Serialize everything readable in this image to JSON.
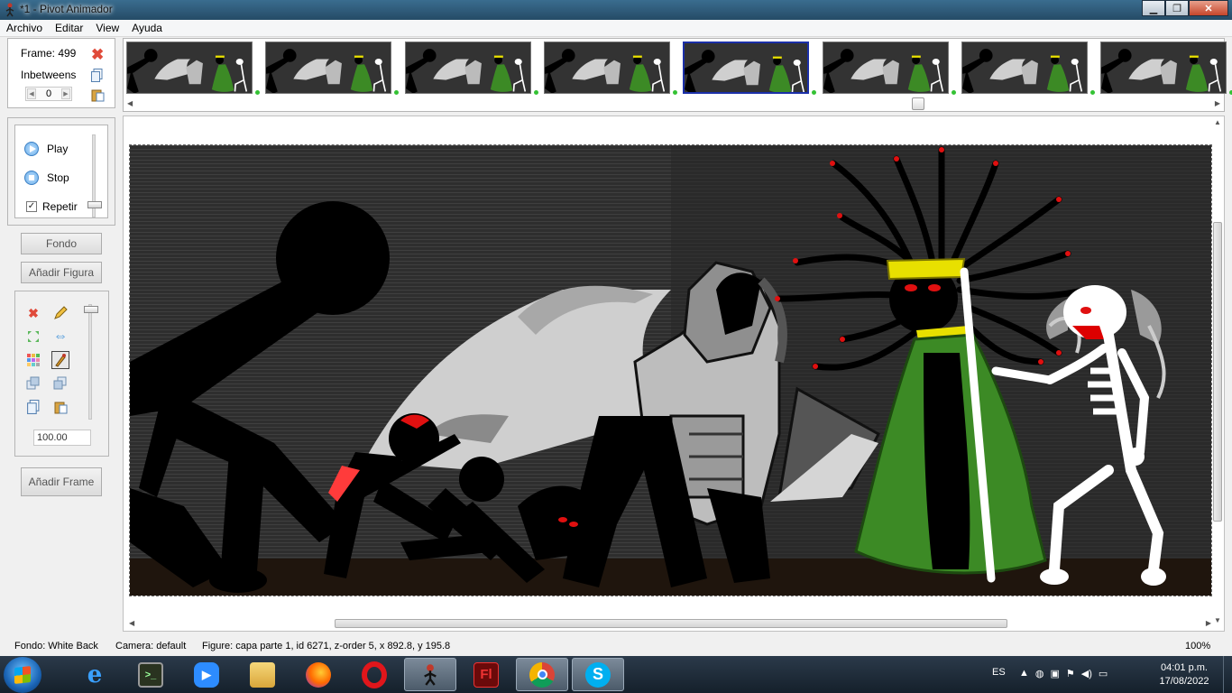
{
  "window": {
    "title": "*1 - Pivot Animador"
  },
  "menu": [
    "Archivo",
    "Editar",
    "View",
    "Ayuda"
  ],
  "frame_panel": {
    "frame_label": "Frame: 499",
    "inbetweens_label": "Inbetweens",
    "inbetweens_value": "0"
  },
  "playback": {
    "play_label": "Play",
    "stop_label": "Stop",
    "repeat_label": "Repetir",
    "repeat_checked": "✓"
  },
  "buttons": {
    "background": "Fondo",
    "add_figure": "Añadir Figura",
    "add_frame": "Añadir Frame"
  },
  "tools": {
    "scale_value": "100.00"
  },
  "timeline": {
    "thumbnail_count": 8,
    "selected_index": 4
  },
  "status": {
    "background": "Fondo: White Back",
    "camera": "Camera: default",
    "figure": "Figure: capa parte 1,  id 6271,  z-order 5,  x 892.8, y 195.8",
    "zoom": "100%"
  },
  "taskbar": {
    "apps": [
      "internet-explorer",
      "terminal",
      "zoom",
      "file-explorer",
      "firefox",
      "opera",
      "pivot-animator",
      "flash",
      "chrome",
      "skype"
    ],
    "language": "ES",
    "time": "04:01 p.m.",
    "date": "17/08/2022"
  },
  "colors": {
    "accent_selected": "#1b2fa8",
    "cape_green": "#3c8a25",
    "crown_yellow": "#e8e000",
    "eyes_red": "#e01010",
    "stage_bg": "#2e2e2e"
  }
}
